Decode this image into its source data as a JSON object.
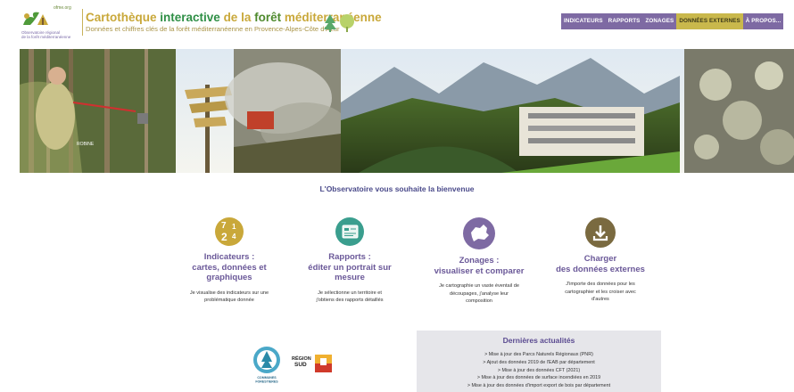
{
  "header": {
    "logo": {
      "site": "ofme.org",
      "name_lines": [
        "Observatoire régional",
        "de la forêt méditerranéenne"
      ]
    },
    "title_parts": [
      "Cartothèque ",
      "interactive",
      " de la ",
      "forêt",
      " méditerranéenne"
    ],
    "subtitle": "Données et chiffres clés de la forêt méditerranéenne en Provence-Alpes-Côte d'Azur"
  },
  "nav": [
    {
      "label": "INDICATEURS",
      "active": false
    },
    {
      "label": "RAPPORTS",
      "active": false
    },
    {
      "label": "ZONAGES",
      "active": false
    },
    {
      "label": "DONNÉES EXTERNES",
      "active": true
    },
    {
      "label": "À PROPOS...",
      "active": false
    }
  ],
  "banner": {
    "sign_text": "ROBINE"
  },
  "welcome": "L'Observatoire vous souhaite la bienvenue",
  "features": [
    {
      "icon": "numbers-icon",
      "color": "#c9a83a",
      "glyphs": [
        "7",
        "1",
        "2",
        "4"
      ],
      "title_lines": [
        "Indicateurs :",
        "cartes, données et",
        "graphiques"
      ],
      "desc_lines": [
        "Je visualise des indicateurs sur une",
        "problématique donnée"
      ]
    },
    {
      "icon": "report-icon",
      "color": "#3a9e8e",
      "title_lines": [
        "Rapports :",
        "éditer un portrait sur",
        "mesure"
      ],
      "desc_lines": [
        "Je sélectionne un territoire et",
        "j'obtiens des rapports détaillés"
      ]
    },
    {
      "icon": "map-icon",
      "color": "#7e6aa3",
      "title_lines": [
        "Zonages :",
        "visualiser et comparer"
      ],
      "desc_lines": [
        "Je cartographie un vaste éventail de",
        "découpages, j'analyse leur",
        "composition"
      ]
    },
    {
      "icon": "download-icon",
      "color": "#7a6a40",
      "title_lines": [
        "Charger",
        "des données externes"
      ],
      "desc_lines": [
        "J'importe des données pour les",
        "cartographier et les croiser avec",
        "d'autres"
      ]
    }
  ],
  "partners": {
    "communes_lines": [
      "COMMUNES",
      "FORESTIERES"
    ],
    "region_lines": [
      "RÉGION",
      "SUD"
    ]
  },
  "news": {
    "title": "Dernières actualités",
    "items": [
      "> Mise à jour des Parcs Naturels Régionaux (PNR)",
      "> Ajout des données 2019 de l'EAB par département",
      "> Mise à jour des données CFT (2021)",
      "> Mise à jour des données de surface incendiées en 2019",
      "> Mise à jour des données d'import export de bois par département"
    ]
  },
  "colors": {
    "accent": "#7e6aa3",
    "gold": "#c9b84c",
    "green": "#2f8f46"
  }
}
